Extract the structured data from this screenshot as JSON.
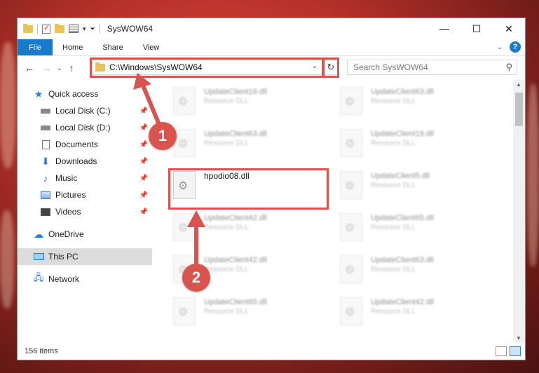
{
  "window": {
    "title": "SysWOW64",
    "controls": {
      "minimize": "—",
      "maximize": "☐",
      "close": "✕"
    }
  },
  "ribbon": {
    "tabs": [
      "File",
      "Home",
      "Share",
      "View"
    ],
    "help": "?"
  },
  "address_bar": {
    "path": "C:\\Windows\\SysWOW64",
    "search_placeholder": "Search SysWOW64"
  },
  "sidebar": {
    "items": [
      {
        "label": "Quick access",
        "icon": "star-icon"
      },
      {
        "label": "Local Disk (C:)",
        "icon": "drive-icon",
        "pinned": true
      },
      {
        "label": "Local Disk (D:)",
        "icon": "drive-icon",
        "pinned": true
      },
      {
        "label": "Documents",
        "icon": "documents-icon",
        "pinned": true
      },
      {
        "label": "Downloads",
        "icon": "downloads-icon",
        "pinned": true
      },
      {
        "label": "Music",
        "icon": "music-icon",
        "pinned": true
      },
      {
        "label": "Pictures",
        "icon": "pictures-icon",
        "pinned": true
      },
      {
        "label": "Videos",
        "icon": "videos-icon",
        "pinned": true
      },
      {
        "label": "OneDrive",
        "icon": "onedrive-icon"
      },
      {
        "label": "This PC",
        "icon": "this-pc-icon",
        "selected": true
      },
      {
        "label": "Network",
        "icon": "network-icon"
      }
    ]
  },
  "files": {
    "left_column": [
      {
        "name": "UpdateClient19.dll",
        "type": "Resource DLL"
      },
      {
        "name": "UpdateClient63.dll",
        "type": "Resource DLL"
      },
      {
        "name": "hpodio08.dll",
        "type": ""
      },
      {
        "name": "UpdateClient42.dll",
        "type": "Resource DLL"
      },
      {
        "name": "UpdateClient42.dll",
        "type": "Resource DLL"
      },
      {
        "name": "UpdateClient65.dll",
        "type": "Resource DLL"
      }
    ],
    "right_column": [
      {
        "name": "UpdateClient63.dll",
        "type": "Resource DLL"
      },
      {
        "name": "UpdateClient19.dll",
        "type": "Resource DLL"
      },
      {
        "name": "UpdateClient5.dll",
        "type": "Resource DLL"
      },
      {
        "name": "UpdateClient65.dll",
        "type": "Resource DLL"
      },
      {
        "name": "UpdateClient63.dll",
        "type": "Resource DLL"
      },
      {
        "name": "UpdateClient42.dll",
        "type": "Resource DLL"
      }
    ]
  },
  "status": {
    "item_count": "156 items"
  },
  "annotations": {
    "badge1": "1",
    "badge2": "2",
    "color": "#d9534f"
  }
}
